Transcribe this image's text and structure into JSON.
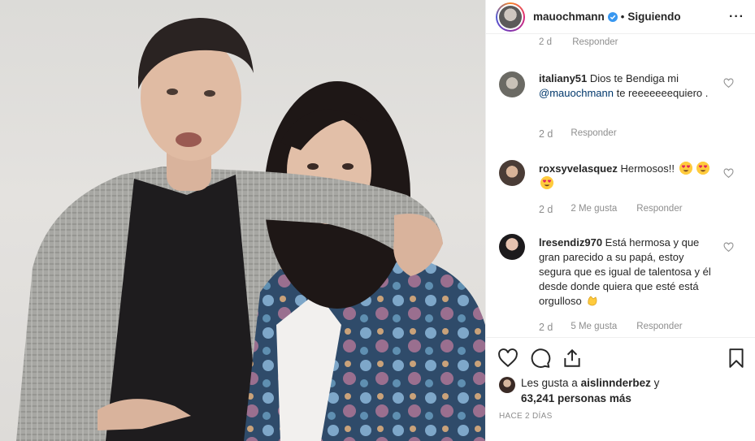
{
  "post": {
    "author": "mauochmann",
    "separator": "•",
    "follow_status": "Siguiendo",
    "more_glyph": "···"
  },
  "ghost_comment": {
    "age": "2 d",
    "reply": "Responder"
  },
  "comments": [
    {
      "user": "italiany51",
      "text_before": "Dios te Bendiga mi",
      "mention": "@mauochmann",
      "text_after": "te reeeeeeequiero .",
      "age": "2 d",
      "reply": "Responder"
    },
    {
      "user": "roxsyvelasquez",
      "text": "Hermosos!!",
      "age": "2 d",
      "likes": "2 Me gusta",
      "reply": "Responder"
    },
    {
      "user": "lresendiz970",
      "text": "Está hermosa y que gran parecido a su papá, estoy segura que es igual de talentosa y él desde donde quiera que esté está orgulloso",
      "age": "2 d",
      "likes": "5 Me gusta",
      "reply": "Responder"
    }
  ],
  "likes": {
    "prefix": "Les gusta a",
    "user": "aislinnderbez",
    "conjunction": "y",
    "count_text": "63,241 personas más"
  },
  "timestamp": "HACE 2 DÍAS",
  "colors": {
    "text": "#262626",
    "muted": "#8e8e8e",
    "mention": "#00376b",
    "verified": "#3897f0",
    "border": "#efefef"
  },
  "icons": [
    "verified-badge-icon",
    "more-options-icon",
    "like-heart-icon",
    "comment-icon",
    "share-icon",
    "bookmark-icon",
    "heart-eyes-emoji-icon",
    "clapping-hands-emoji-icon"
  ]
}
